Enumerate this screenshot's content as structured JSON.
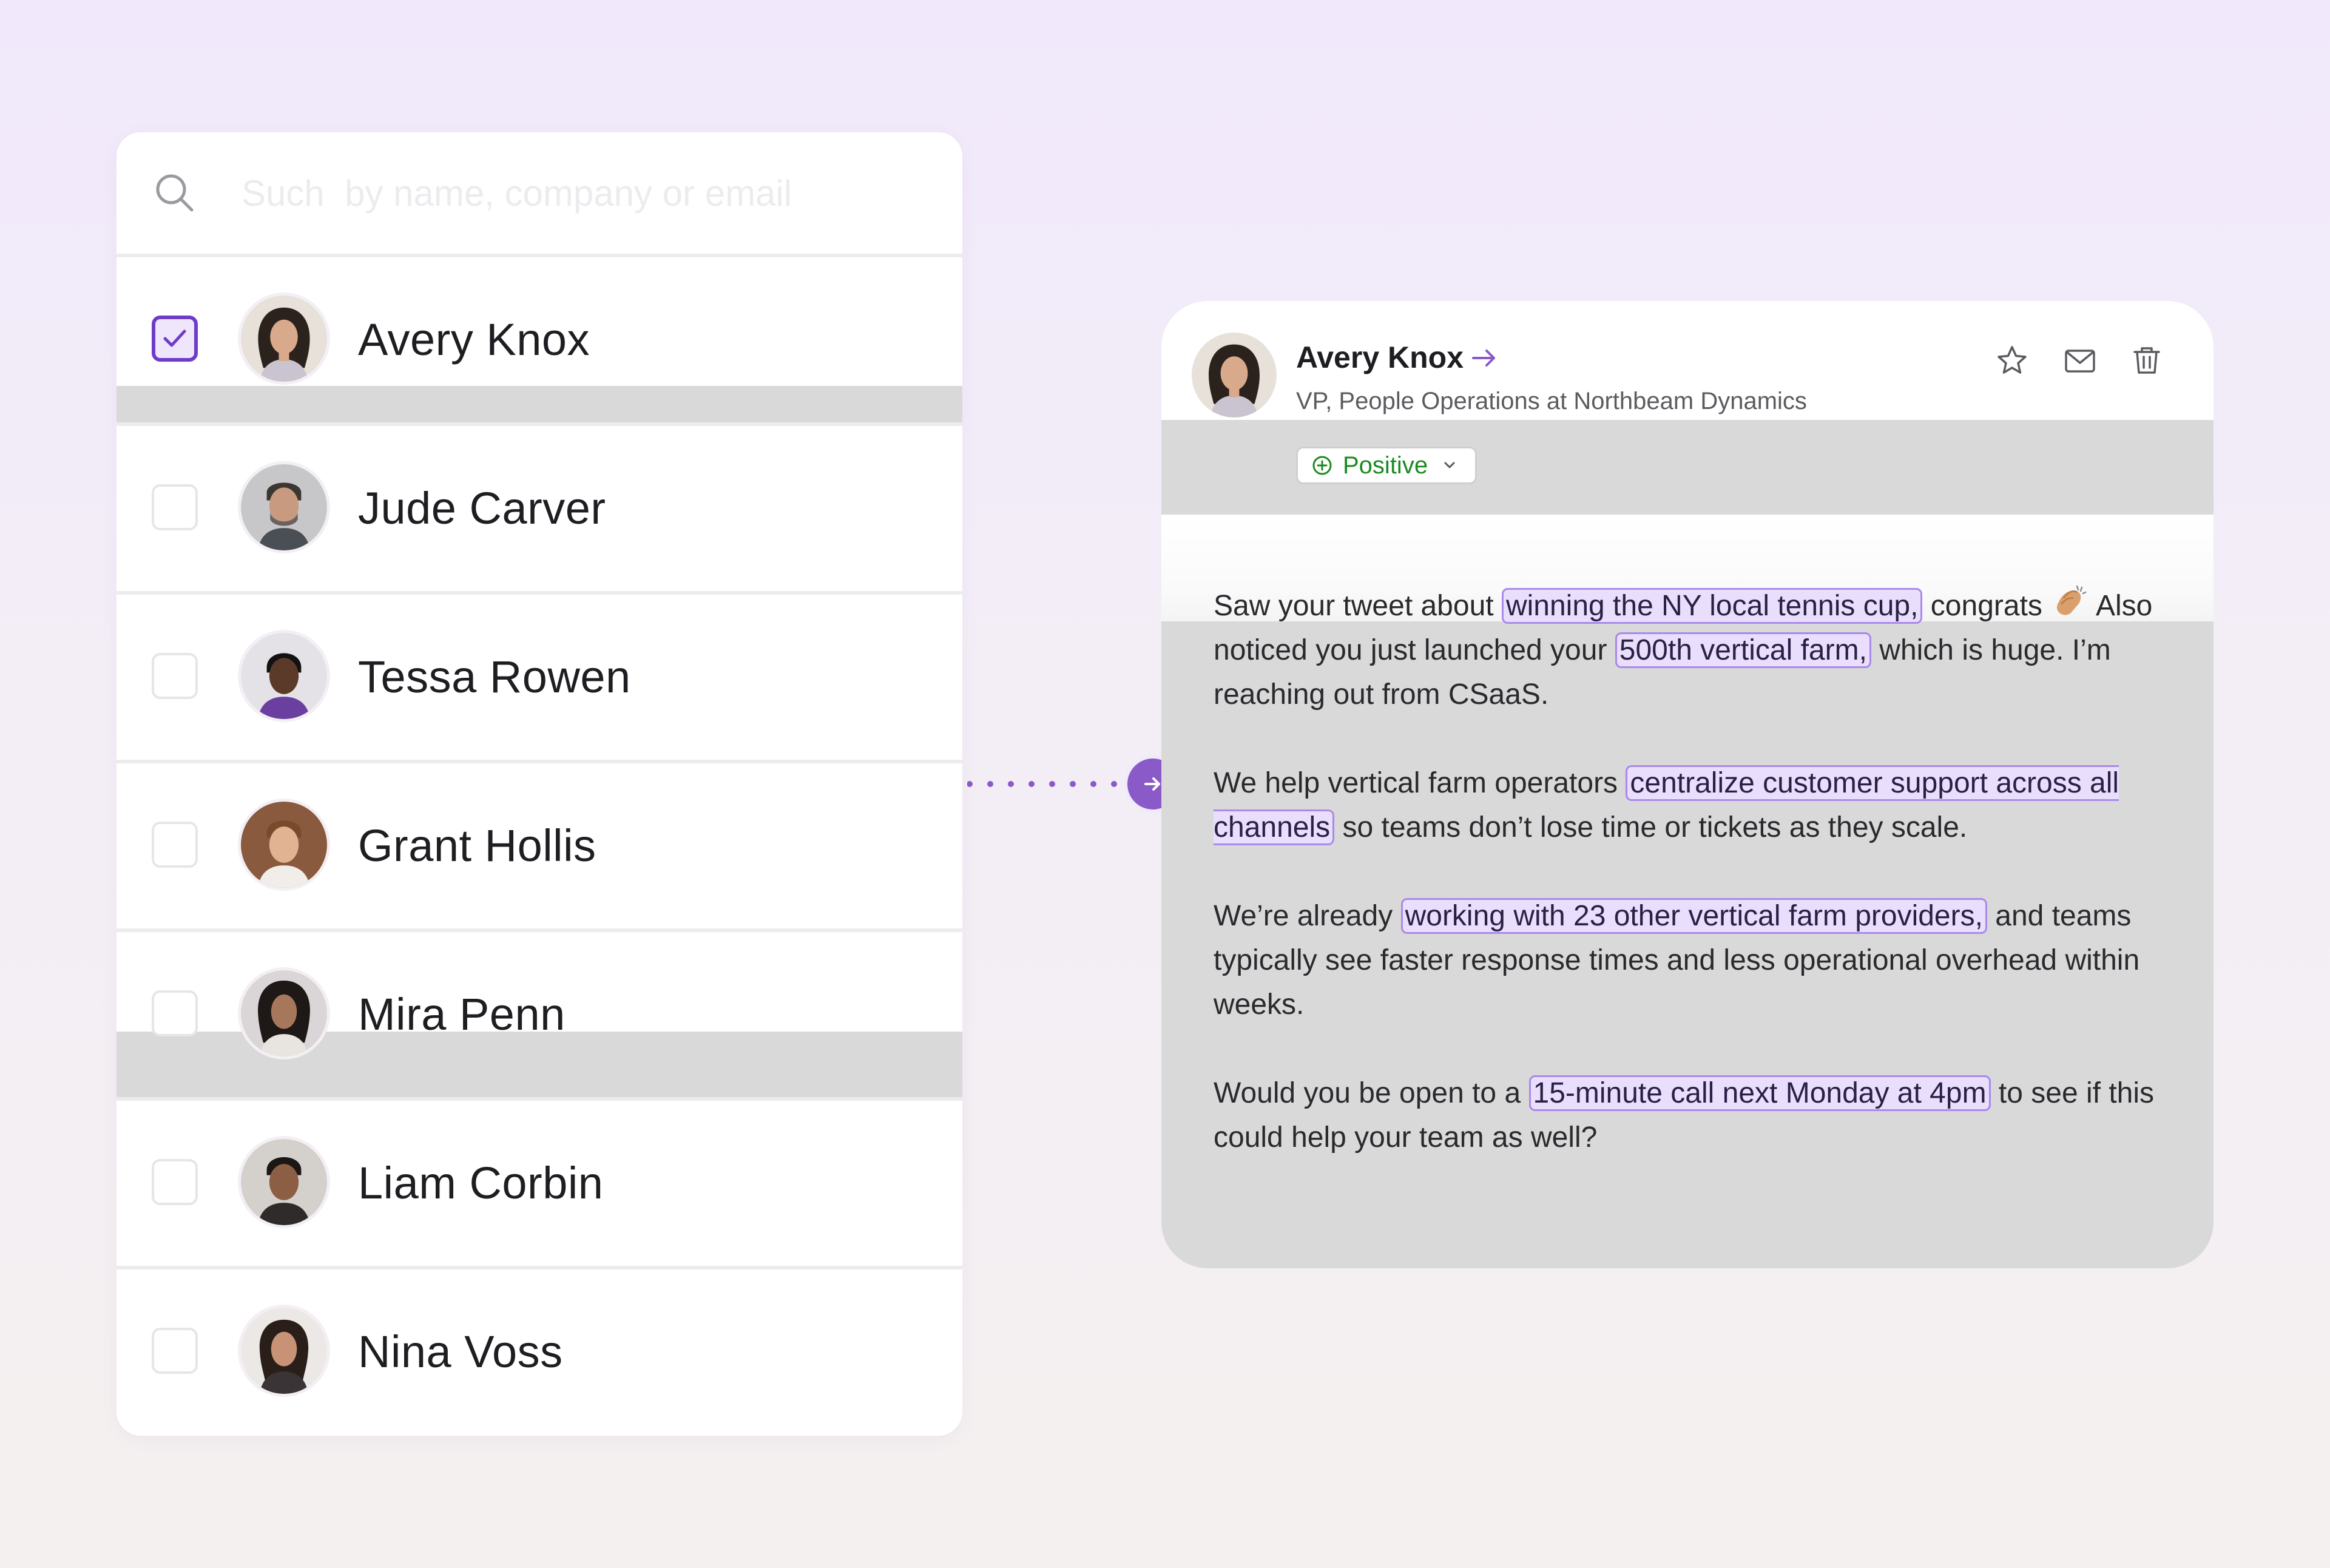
{
  "search": {
    "placeholder": "Such  by name, company or email"
  },
  "contacts": [
    {
      "name": "Avery Knox",
      "checked": true
    },
    {
      "name": "Jude Carver",
      "checked": false
    },
    {
      "name": "Tessa Rowen",
      "checked": false
    },
    {
      "name": "Grant Hollis",
      "checked": false
    },
    {
      "name": "Mira Penn",
      "checked": false
    },
    {
      "name": "Liam Corbin",
      "checked": false
    },
    {
      "name": "Nina Voss",
      "checked": false
    }
  ],
  "message": {
    "name": "Avery Knox",
    "title": "VP, People Operations at Northbeam Dynamics",
    "status": "Positive",
    "p1": {
      "t1": "Saw your tweet about ",
      "h1": "winning the NY local tennis cup,",
      "t2": " congrats ",
      "t3": " Also noticed you just launched your ",
      "h2": "500th vertical farm,",
      "t4": " which is huge. I’m reaching out from CSaaS."
    },
    "p2": {
      "t1": "We help vertical farm operators ",
      "h1": "centralize customer support across all channels",
      "t2": " so teams don’t lose time or tickets as they scale."
    },
    "p3": {
      "t1": "We’re already ",
      "h1": "working with 23 other vertical farm providers,",
      "t2": " and teams typically see faster response times and less operational overhead within weeks."
    },
    "p4": {
      "t1": "Would you be open to a ",
      "h1": "15-minute call next Monday at 4pm",
      "t2": " to see if this could help your team as well?"
    }
  },
  "icons": {
    "search": "search-icon",
    "checkbox_checked": "check-icon",
    "connector": "dotted-connector",
    "go": "arrow-right-icon",
    "open_profile": "arrow-right-icon",
    "star": "star-icon",
    "mail": "mail-icon",
    "delete": "trash-icon",
    "status": "plus-circle-icon",
    "dropdown": "chevron-down-icon",
    "emoji": "clapping-hands-emoji"
  },
  "colors": {
    "accent": "#6F3CC7",
    "connector": "#8A5AC8",
    "positive": "#1C8A22",
    "highlight_bg": "#E9DFFC",
    "highlight_border": "#A989EA"
  }
}
